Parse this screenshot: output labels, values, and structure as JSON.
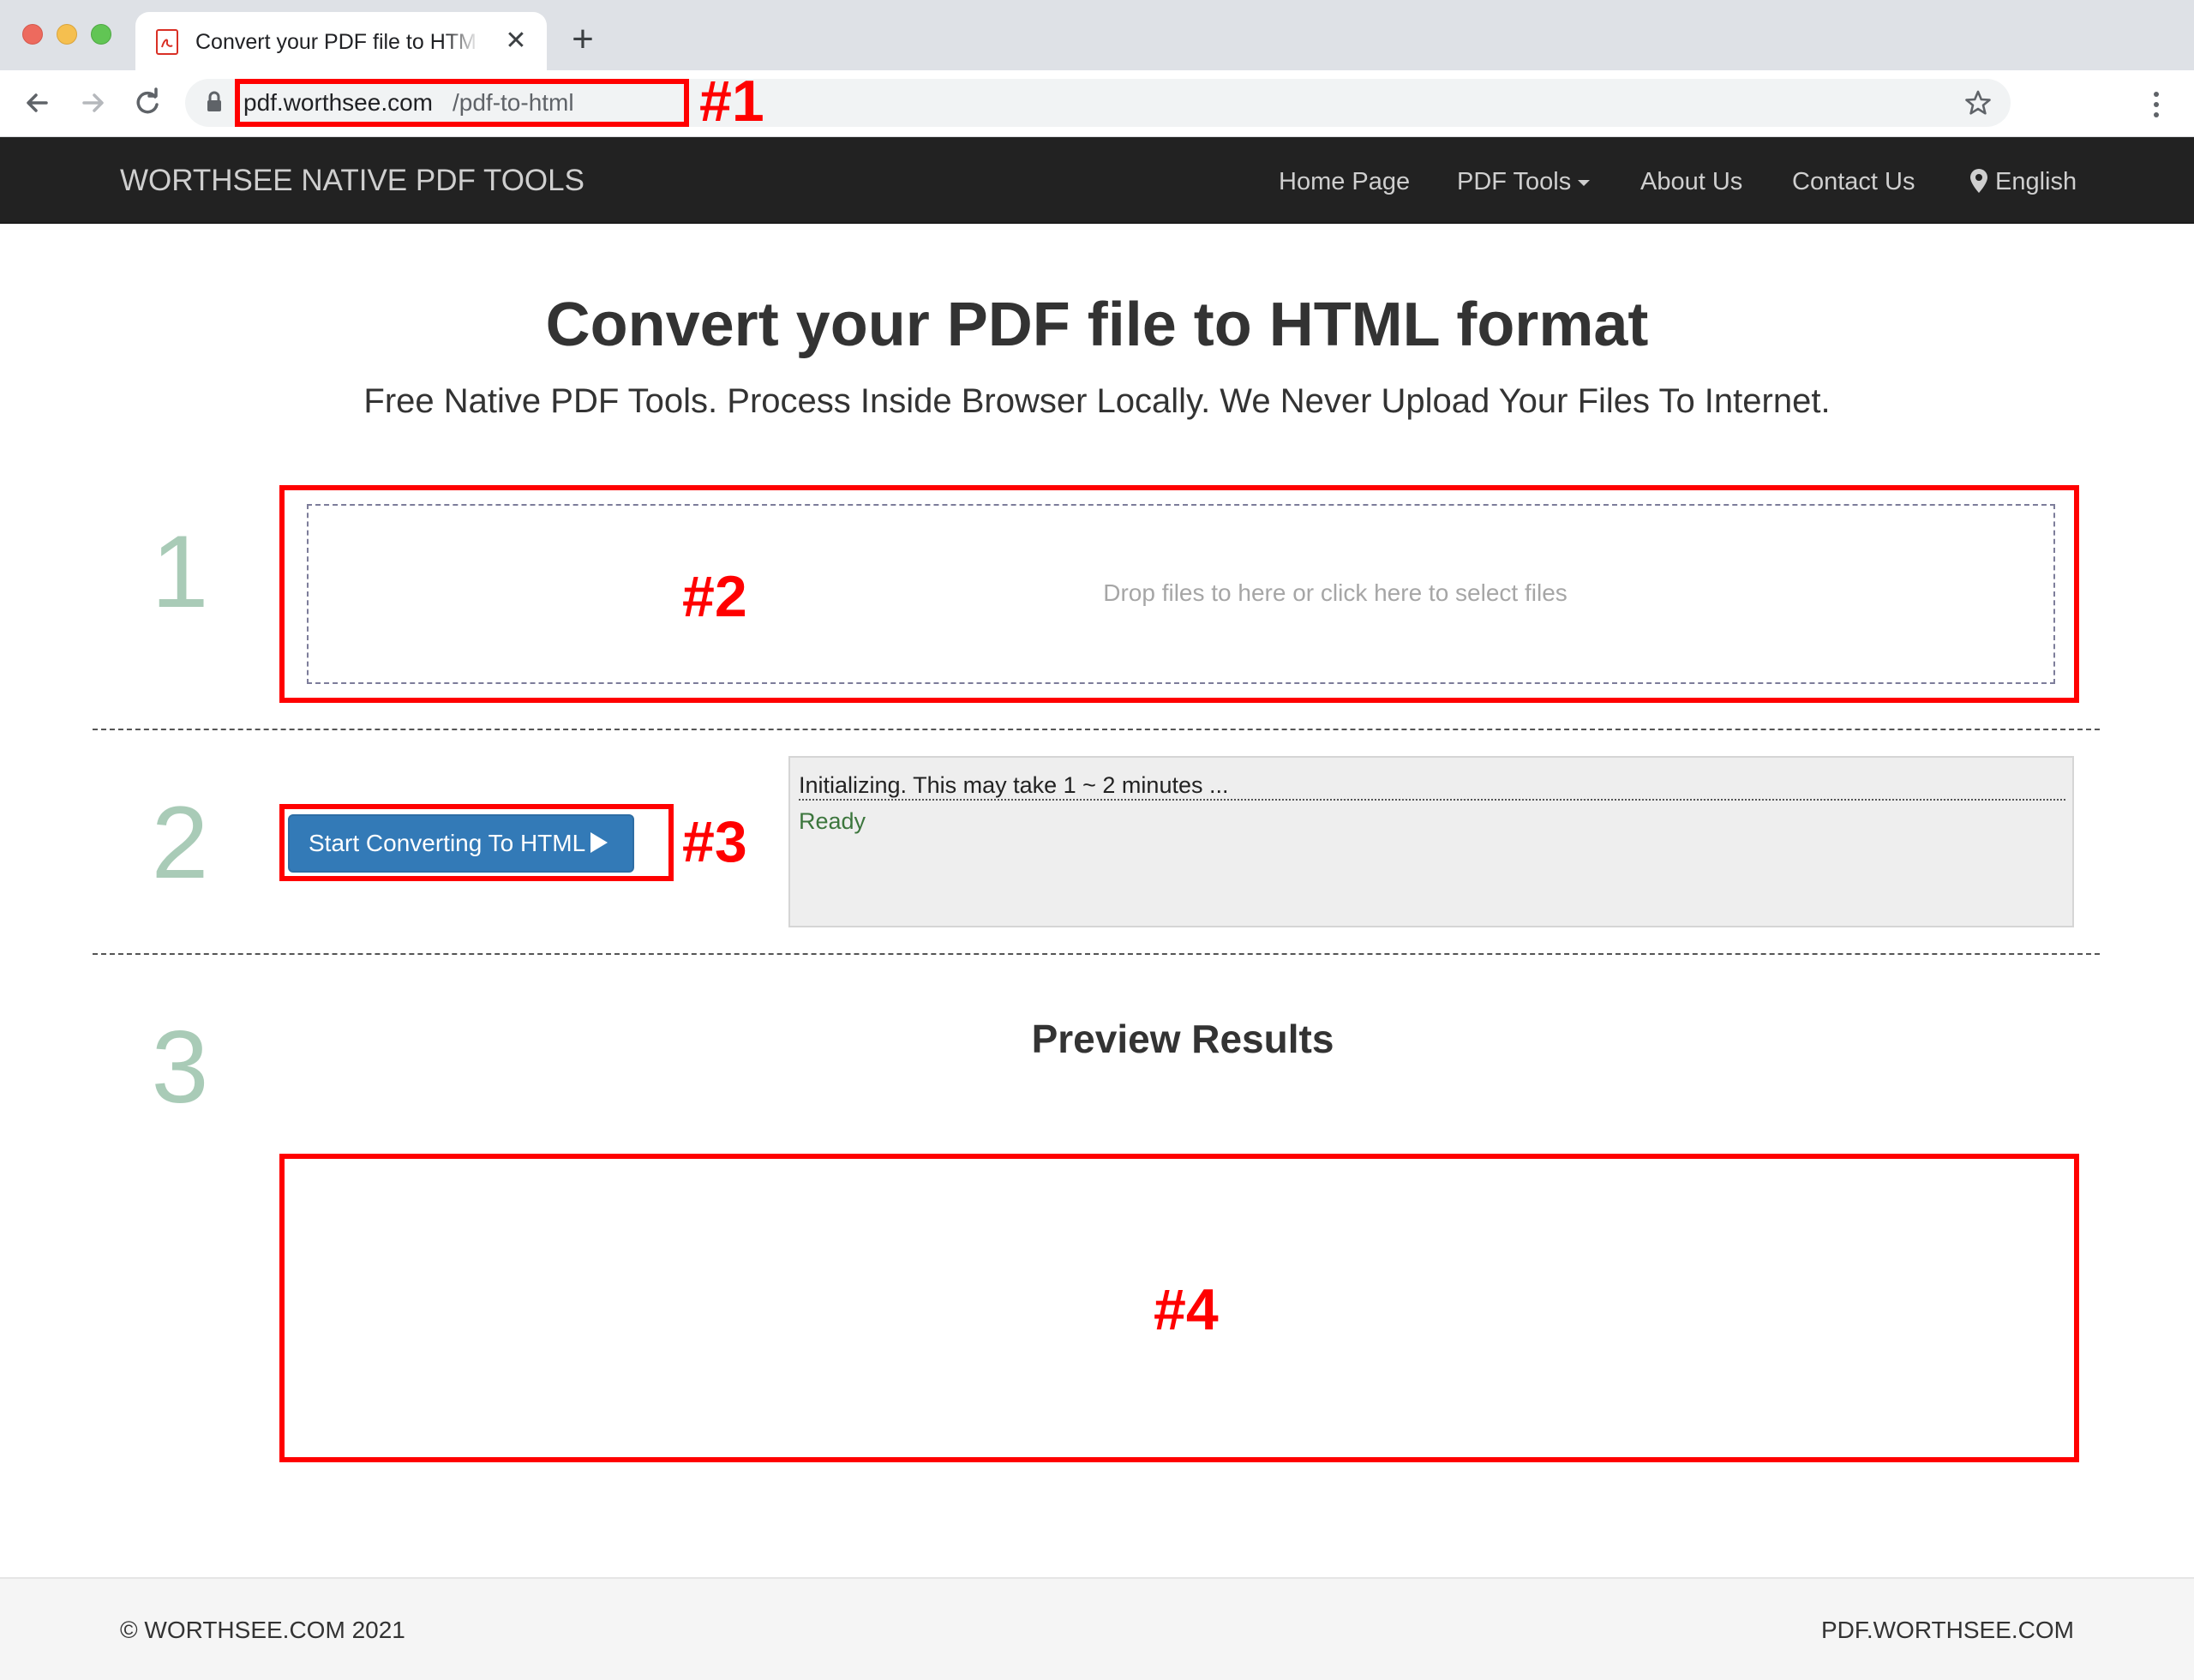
{
  "browser": {
    "tab": {
      "title": "Convert your PDF file to HTML",
      "close_glyph": "✕",
      "favicon": "pdf-file-icon"
    },
    "new_tab_glyph": "+",
    "address": {
      "host": "pdf.worthsee.com",
      "path": "/pdf-to-html"
    },
    "icons": [
      "back-arrow-icon",
      "forward-arrow-icon",
      "reload-icon",
      "lock-icon",
      "star-icon",
      "kebab-menu-icon"
    ]
  },
  "navbar": {
    "brand": "WORTHSEE NATIVE PDF TOOLS",
    "links": {
      "home": "Home Page",
      "tools": "PDF Tools",
      "about": "About Us",
      "contact": "Contact Us",
      "language": "English"
    }
  },
  "main": {
    "title": "Convert your PDF file to HTML format",
    "subtitle": "Free Native PDF Tools. Process Inside Browser Locally. We Never Upload Your Files To Internet.",
    "steps": {
      "one": "1",
      "two": "2",
      "three": "3"
    },
    "dropzone_text": "Drop files to here or click here to select files",
    "convert_button": "Start Converting To HTML",
    "log": {
      "message": "Initializing. This may take 1 ~ 2 minutes ...",
      "status": "Ready"
    },
    "preview_title": "Preview Results"
  },
  "annotations": {
    "a1": "#1",
    "a2": "#2",
    "a3": "#3",
    "a4": "#4",
    "color": "#ff0000"
  },
  "footer": {
    "left": "© WORTHSEE.COM 2021",
    "right": "PDF.WORTHSEE.COM"
  },
  "colors": {
    "navbar_bg": "#222222",
    "button_bg": "#337ab7",
    "step_number": "#a9cbb7",
    "status_ready": "#3c763d"
  }
}
